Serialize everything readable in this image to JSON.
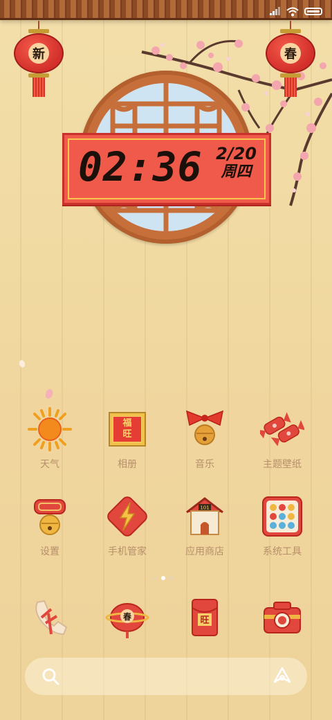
{
  "clock": {
    "time": "02:36",
    "date": "2/20",
    "weekday": "周四"
  },
  "lanterns": {
    "left_char": "新",
    "right_char": "春"
  },
  "apps_row1": [
    {
      "label": "天气",
      "icon": "sun-icon"
    },
    {
      "label": "相册",
      "icon": "gallery-icon"
    },
    {
      "label": "音乐",
      "icon": "bell-bow-icon"
    },
    {
      "label": "主题壁纸",
      "icon": "candy-icon"
    }
  ],
  "apps_row2": [
    {
      "label": "设置",
      "icon": "gear-bell-icon"
    },
    {
      "label": "手机管家",
      "icon": "lightning-icon"
    },
    {
      "label": "应用商店",
      "icon": "house-icon"
    },
    {
      "label": "系统工具",
      "icon": "tools-grid-icon"
    }
  ],
  "dock": [
    {
      "icon": "phone-icon"
    },
    {
      "icon": "lantern-message-icon",
      "char": "春"
    },
    {
      "icon": "red-envelope-icon",
      "char": "旺"
    },
    {
      "icon": "camera-icon"
    }
  ],
  "gallery_chars": [
    "福",
    "旺"
  ],
  "house_sign": "101",
  "colors": {
    "background": "#f0d79f",
    "banner": "#f05a4a",
    "frame": "#c76f3a",
    "label": "#b78f6a"
  }
}
